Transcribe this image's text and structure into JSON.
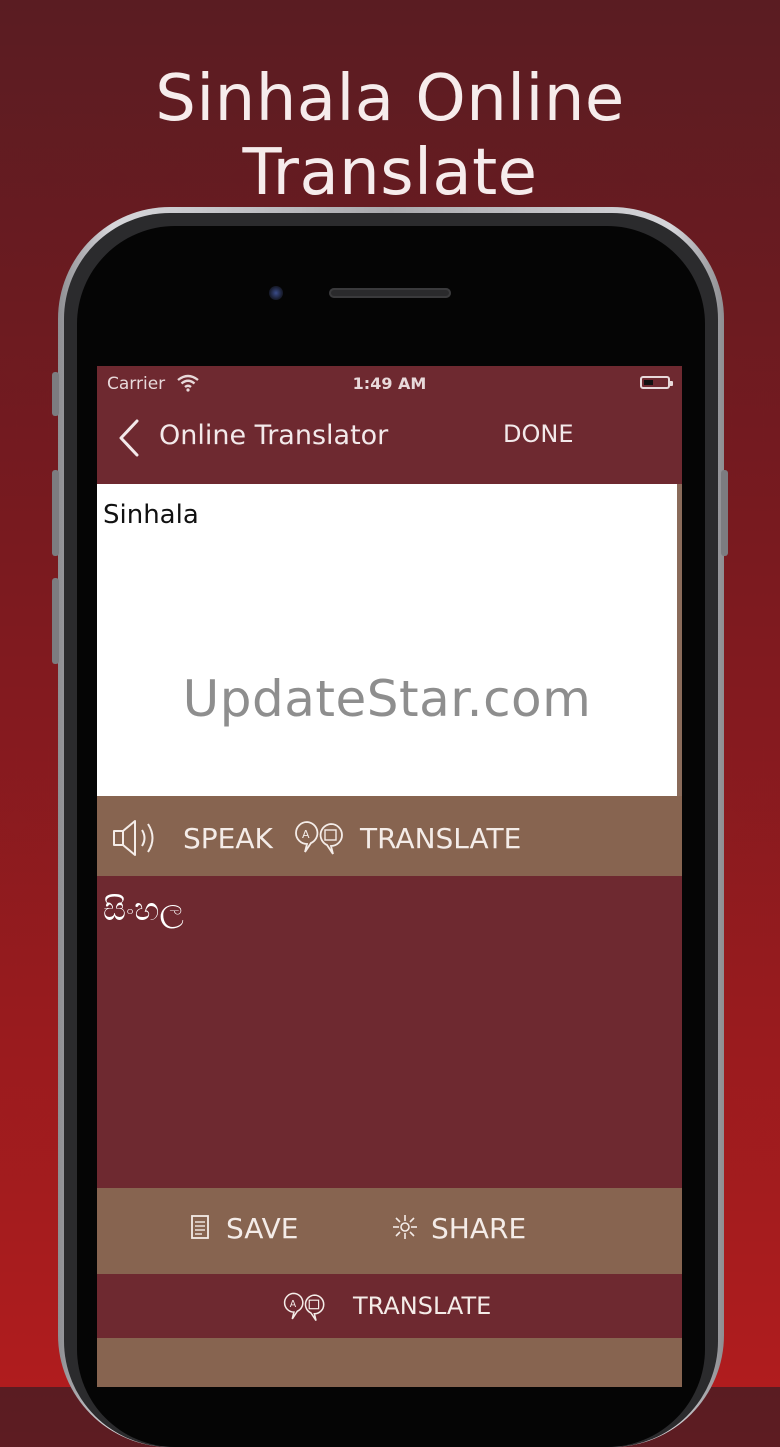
{
  "banner": {
    "title": "Sinhala Online Translate"
  },
  "status_bar": {
    "carrier": "Carrier",
    "time": "1:49 AM"
  },
  "nav": {
    "back_icon": "chevron-left-icon",
    "title": "Online Translator",
    "done_label": "DONE"
  },
  "input": {
    "text": "Sinhala",
    "watermark": "UpdateStar.com"
  },
  "actions": {
    "speak_icon": "speaker-icon",
    "speak_label": "SPEAK",
    "translate_icon": "translate-icon",
    "translate_label": "TRANSLATE"
  },
  "output": {
    "text": "සිංහල"
  },
  "bottom_bar": {
    "save_icon": "notepad-icon",
    "save_label": "SAVE",
    "share_icon": "share-icon",
    "share_label": "SHARE"
  },
  "bottom_translate": {
    "icon": "translate-icon",
    "label": "TRANSLATE"
  },
  "colors": {
    "background_top": "#5a1c22",
    "background_bottom": "#b01c1e",
    "screen_maroon": "#6e2930",
    "action_brown": "#876450",
    "text_light": "#f4ece8"
  }
}
